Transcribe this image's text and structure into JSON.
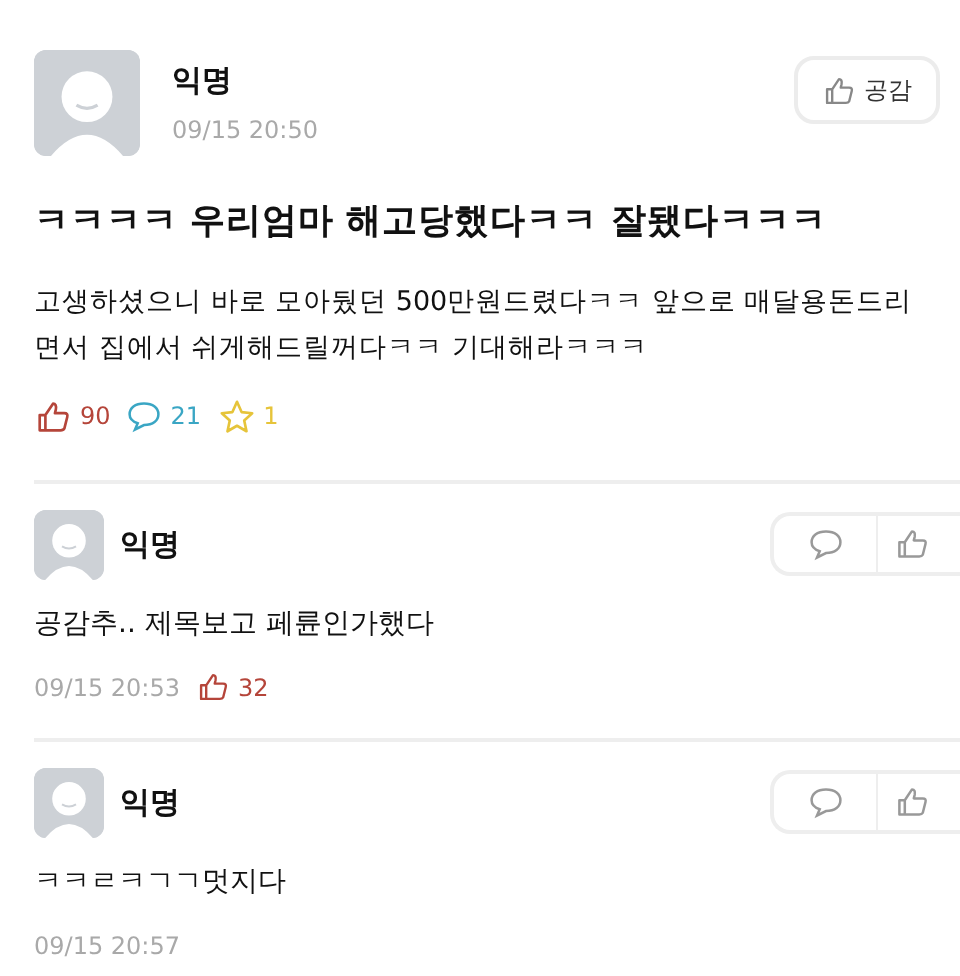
{
  "post": {
    "author": "익명",
    "time": "09/15 20:50",
    "like_button": "공감",
    "title": "ㅋㅋㅋㅋ 우리엄마 해고당했다ㅋㅋ 잘됐다ㅋㅋㅋ",
    "body": "고생하셨으니 바로 모아뒀던 500만원드렸다ㅋㅋ 앞으로 매달용돈드리면서 집에서 쉬게해드릴꺼다ㅋㅋ 기대해라ㅋㅋㅋ",
    "likes": "90",
    "comments": "21",
    "scraps": "1"
  },
  "comments": [
    {
      "author": "익명",
      "text": "공감추.. 제목보고 페륜인가했다",
      "time": "09/15 20:53",
      "likes": "32"
    },
    {
      "author": "익명",
      "text": "ㅋㅋㄹㅋㄱㄱ멋지다",
      "time": "09/15 20:57"
    }
  ]
}
